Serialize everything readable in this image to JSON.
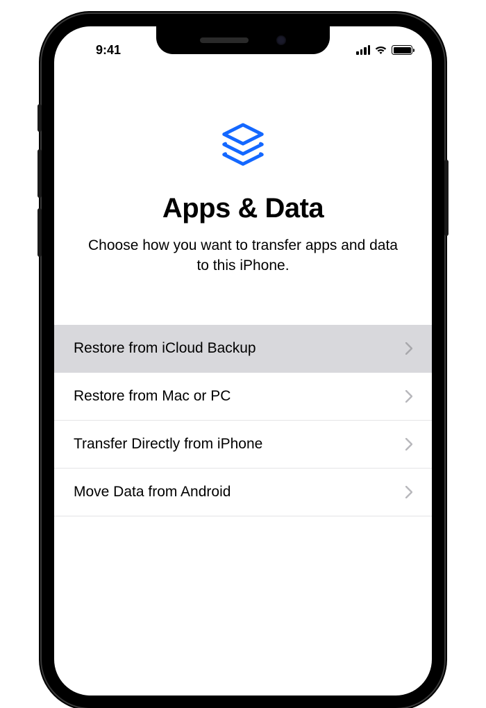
{
  "status_bar": {
    "time": "9:41"
  },
  "header": {
    "icon": "layers-stack-icon",
    "title": "Apps & Data",
    "subtitle": "Choose how you want to transfer apps and data to this iPhone."
  },
  "options": [
    {
      "label": "Restore from iCloud Backup",
      "highlighted": true
    },
    {
      "label": "Restore from Mac or PC",
      "highlighted": false
    },
    {
      "label": "Transfer Directly from iPhone",
      "highlighted": false
    },
    {
      "label": "Move Data from Android",
      "highlighted": false
    }
  ],
  "colors": {
    "accent": "#1468ff",
    "highlight_bg": "#d8d8dc"
  }
}
